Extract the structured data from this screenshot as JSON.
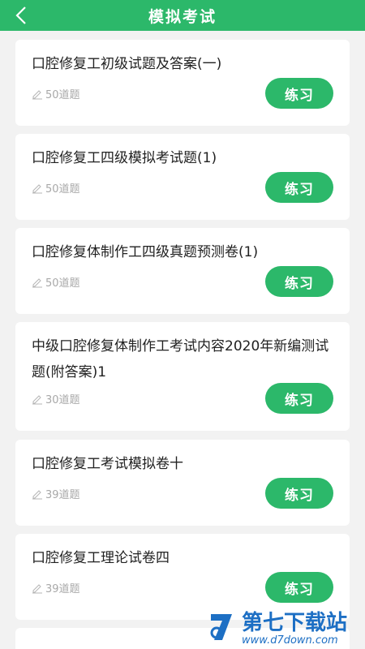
{
  "header": {
    "title": "模拟考试"
  },
  "cards": [
    {
      "title": "口腔修复工初级试题及答案(一)",
      "count": "50道题",
      "button": "练习"
    },
    {
      "title": "口腔修复工四级模拟考试题(1)",
      "count": "50道题",
      "button": "练习"
    },
    {
      "title": "口腔修复体制作工四级真题预测卷(1)",
      "count": "50道题",
      "button": "练习"
    },
    {
      "title": "中级口腔修复体制作工考试内容2020年新编测试题(附答案)1",
      "count": "30道题",
      "button": "练习"
    },
    {
      "title": "口腔修复工考试模拟卷十",
      "count": "39道题",
      "button": "练习"
    },
    {
      "title": "口腔修复工理论试卷四",
      "count": "39道题",
      "button": "练习"
    }
  ],
  "watermark": {
    "name": "第七下载站",
    "url": "www.d7down.com"
  },
  "colors": {
    "accent": "#2cb86a",
    "watermark": "#1d6fc4"
  }
}
